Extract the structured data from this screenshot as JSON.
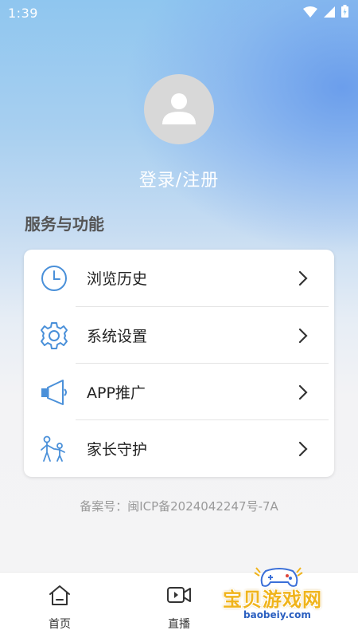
{
  "status_bar": {
    "time": "1:39",
    "icons": [
      "wifi-icon",
      "signal-icon",
      "battery-icon"
    ]
  },
  "profile": {
    "avatar_icon": "user-avatar-icon",
    "login_label": "登录/注册"
  },
  "services": {
    "title": "服务与功能",
    "items": [
      {
        "label": "浏览历史",
        "icon": "clock-icon"
      },
      {
        "label": "系统设置",
        "icon": "gear-icon"
      },
      {
        "label": "APP推广",
        "icon": "megaphone-icon"
      },
      {
        "label": "家长守护",
        "icon": "family-icon"
      }
    ]
  },
  "footer": {
    "icp": "备案号：闽ICP备2024042247号-7A"
  },
  "bottom_nav": {
    "items": [
      {
        "label": "首页",
        "icon": "home-icon"
      },
      {
        "label": "直播",
        "icon": "video-icon"
      }
    ]
  },
  "watermark": {
    "text": "宝贝游戏网",
    "url": "baobeiy.com"
  },
  "colors": {
    "accent_blue": "#4a90d9",
    "watermark_gold": "#f0b41c"
  }
}
